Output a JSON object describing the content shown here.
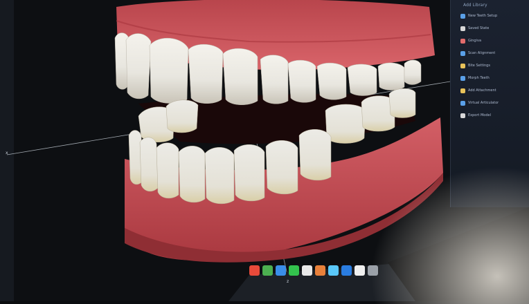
{
  "app": {
    "panel_title": "Add Library",
    "panel_items": [
      {
        "label": "New Teeth Setup",
        "icon": "tooth-icon",
        "color": "#5aa0e8"
      },
      {
        "label": "Saved State",
        "icon": "save-icon",
        "color": "#d8d8d8"
      },
      {
        "label": "Gingiva",
        "icon": "gum-icon",
        "color": "#e26c6c"
      },
      {
        "label": "Scan Alignment",
        "icon": "align-icon",
        "color": "#5aa0e8"
      },
      {
        "label": "Bite Settings",
        "icon": "bite-icon",
        "color": "#e8c25a"
      },
      {
        "label": "Morph Teeth",
        "icon": "morph-icon",
        "color": "#5aa0e8"
      },
      {
        "label": "Add Attachment",
        "icon": "attach-icon",
        "color": "#e8c25a"
      },
      {
        "label": "Virtual Articulator",
        "icon": "articulator-icon",
        "color": "#5aa0e8"
      },
      {
        "label": "Export Model",
        "icon": "export-icon",
        "color": "#d8d8d8"
      }
    ],
    "axis_labels": {
      "left": "x",
      "bottom": "z"
    },
    "taskbar_icons": [
      {
        "name": "browser-icon",
        "color": "#e84a3a"
      },
      {
        "name": "chrome-icon",
        "color": "#4caf50"
      },
      {
        "name": "mail-icon",
        "color": "#3a8ee8"
      },
      {
        "name": "messages-icon",
        "color": "#33c24d"
      },
      {
        "name": "files-icon",
        "color": "#e8e8e8"
      },
      {
        "name": "photos-icon",
        "color": "#e8803a"
      },
      {
        "name": "finder-icon",
        "color": "#5ac8fa"
      },
      {
        "name": "safari-icon",
        "color": "#2a7de1"
      },
      {
        "name": "notes-icon",
        "color": "#f0f0f0"
      },
      {
        "name": "settings-icon",
        "color": "#9aa0a8"
      }
    ]
  }
}
